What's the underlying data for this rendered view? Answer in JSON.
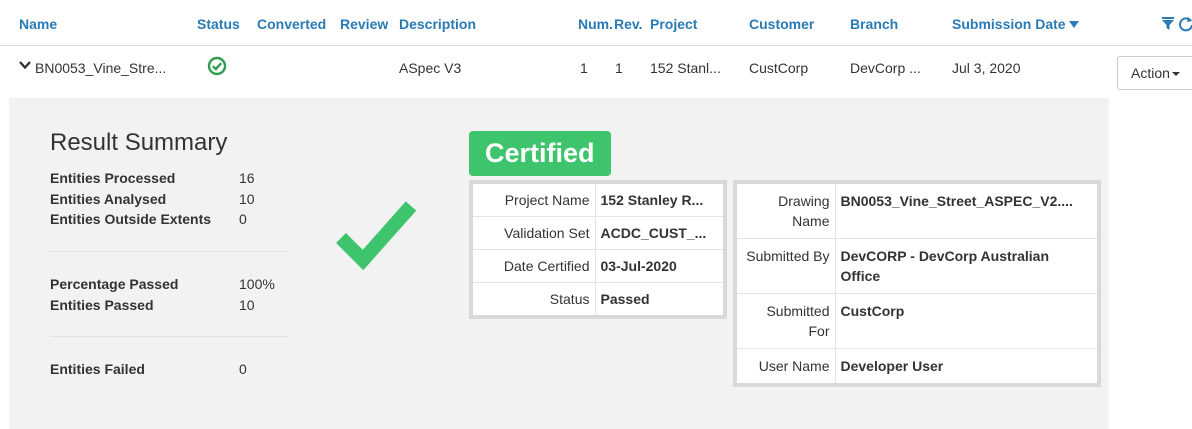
{
  "header": {
    "columns": {
      "name": "Name",
      "status": "Status",
      "converted": "Converted",
      "review": "Review",
      "description": "Description",
      "num": "Num.",
      "rev": "Rev.",
      "project": "Project",
      "customer": "Customer",
      "branch": "Branch",
      "submission_date": "Submission Date"
    }
  },
  "row": {
    "name": "BN0053_Vine_Stre...",
    "description": "ASpec V3",
    "num": "1",
    "rev": "1",
    "project": "152 Stanl...",
    "customer": "CustCorp",
    "branch": "DevCorp ...",
    "submission_date": "Jul 3, 2020",
    "action_label": "Action"
  },
  "summary": {
    "title": "Result Summary",
    "entities_processed_label": "Entities Processed",
    "entities_processed": "16",
    "entities_analysed_label": "Entities Analysed",
    "entities_analysed": "10",
    "entities_outside_label": "Entities Outside Extents",
    "entities_outside": "0",
    "percentage_passed_label": "Percentage Passed",
    "percentage_passed": "100%",
    "entities_passed_label": "Entities Passed",
    "entities_passed": "10",
    "entities_failed_label": "Entities Failed",
    "entities_failed": "0"
  },
  "certificate": {
    "badge": "Certified",
    "project_name_label": "Project Name",
    "project_name": "152 Stanley R...",
    "validation_set_label": "Validation Set",
    "validation_set": "ACDC_CUST_...",
    "date_certified_label": "Date Certified",
    "date_certified": "03-Jul-2020",
    "status_label": "Status",
    "status": "Passed",
    "drawing_name_label": "Drawing Name",
    "drawing_name": "BN0053_Vine_Street_ASPEC_V2....",
    "submitted_by_label": "Submitted By",
    "submitted_by": "DevCORP - DevCorp Australian Office",
    "submitted_for_label": "Submitted For",
    "submitted_for": "CustCorp",
    "user_name_label": "User Name",
    "user_name": "Developer User"
  },
  "colors": {
    "header_text": "#2a7ab5",
    "success": "#3ec46d",
    "status_icon": "#2e9e4f",
    "panel_bg": "#f2f2f2"
  },
  "icons": {
    "sort": "chevron-down-icon",
    "filter": "filter-icon",
    "refresh": "refresh-icon",
    "expand": "chevron-down-icon",
    "status": "check-circle-icon",
    "result": "checkmark-icon"
  }
}
